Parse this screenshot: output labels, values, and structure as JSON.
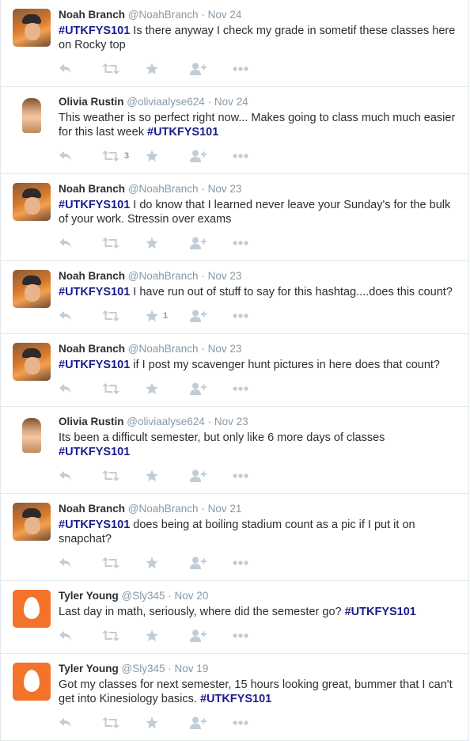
{
  "tweets": [
    {
      "avatar": "noah",
      "name": "Noah Branch",
      "handle": "@NoahBranch",
      "date": "Nov 24",
      "segments": [
        {
          "t": "#UTKFYS101",
          "tag": true
        },
        {
          "t": " Is there anyway I check my grade in sometif these classes here on Rocky top",
          "tag": false
        }
      ],
      "fav_count": "",
      "rt_count": ""
    },
    {
      "avatar": "olivia",
      "name": "Olivia Rustin",
      "handle": "@oliviaalyse624",
      "date": "Nov 24",
      "segments": [
        {
          "t": "This weather is so perfect right now... Makes going to class much much easier for this last week ",
          "tag": false
        },
        {
          "t": "#UTKFYS101",
          "tag": true
        }
      ],
      "fav_count": "",
      "rt_count": "3"
    },
    {
      "avatar": "noah",
      "name": "Noah Branch",
      "handle": "@NoahBranch",
      "date": "Nov 23",
      "segments": [
        {
          "t": "#UTKFYS101",
          "tag": true
        },
        {
          "t": " I do know that I learned never leave your Sunday's for the bulk of your work. Stressin over exams",
          "tag": false
        }
      ],
      "fav_count": "",
      "rt_count": ""
    },
    {
      "avatar": "noah",
      "name": "Noah Branch",
      "handle": "@NoahBranch",
      "date": "Nov 23",
      "segments": [
        {
          "t": "#UTKFYS101",
          "tag": true
        },
        {
          "t": " I have run out of stuff to say for this hashtag....does this count?",
          "tag": false
        }
      ],
      "fav_count": "1",
      "rt_count": ""
    },
    {
      "avatar": "noah",
      "name": "Noah Branch",
      "handle": "@NoahBranch",
      "date": "Nov 23",
      "segments": [
        {
          "t": "#UTKFYS101",
          "tag": true
        },
        {
          "t": " if I post my scavenger hunt pictures in here does that count?",
          "tag": false
        }
      ],
      "fav_count": "",
      "rt_count": ""
    },
    {
      "avatar": "olivia",
      "name": "Olivia Rustin",
      "handle": "@oliviaalyse624",
      "date": "Nov 23",
      "segments": [
        {
          "t": "Its been a difficult semester, but only like 6 more days of classes  ",
          "tag": false
        },
        {
          "t": "#UTKFYS101",
          "tag": true
        }
      ],
      "fav_count": "",
      "rt_count": ""
    },
    {
      "avatar": "noah",
      "name": "Noah Branch",
      "handle": "@NoahBranch",
      "date": "Nov 21",
      "segments": [
        {
          "t": "#UTKFYS101",
          "tag": true
        },
        {
          "t": " does being at boiling stadium count as a pic if I put it on snapchat?",
          "tag": false
        }
      ],
      "fav_count": "",
      "rt_count": ""
    },
    {
      "avatar": "egg",
      "name": "Tyler Young",
      "handle": "@Sly345",
      "date": "Nov 20",
      "segments": [
        {
          "t": "Last day in math, seriously, where did the semester go? ",
          "tag": false
        },
        {
          "t": "#UTKFYS101",
          "tag": true
        }
      ],
      "fav_count": "",
      "rt_count": ""
    },
    {
      "avatar": "egg",
      "name": "Tyler Young",
      "handle": "@Sly345",
      "date": "Nov 19",
      "segments": [
        {
          "t": "Got my classes for next semester, 15 hours looking great, bummer that I can't get into Kinesiology basics. ",
          "tag": false
        },
        {
          "t": "#UTKFYS101",
          "tag": true
        }
      ],
      "fav_count": "",
      "rt_count": ""
    }
  ],
  "separator": "·",
  "icons": {
    "reply": "reply-icon",
    "retweet": "retweet-icon",
    "favorite": "star-icon",
    "follow": "follow-icon",
    "more": "more-icon"
  },
  "colors": {
    "hashtag": "#1b1b8c",
    "meta": "#8899a6",
    "icon": "#c2ccd4",
    "egg": "#f5722b"
  }
}
